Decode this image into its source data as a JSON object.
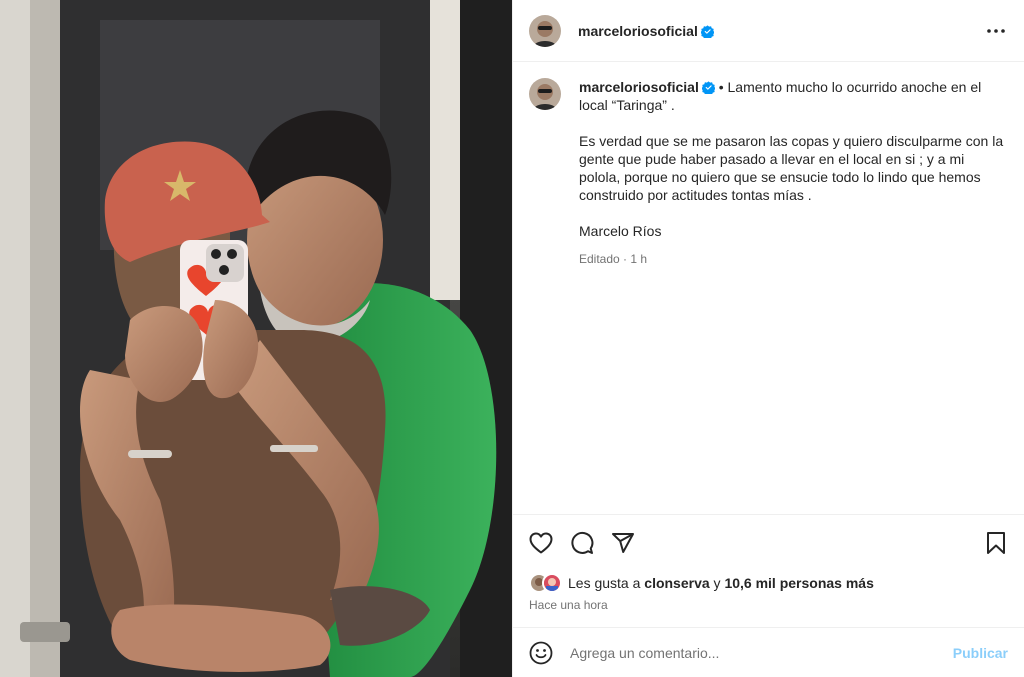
{
  "post": {
    "username": "marceloriosoficial",
    "verified": true
  },
  "caption": {
    "username": "marceloriosoficial",
    "intro": "• Lamento mucho lo ocurrido anoche en el local “Taringa” .",
    "body": "Es verdad que se me pasaron las copas y quiero disculparme con la gente que pude haber pasado a llevar en el local en si ; y a mi polola, porque no quiero que se ensucie todo lo lindo que hemos construido por actitudes tontas mías .",
    "signature": "Marcelo Ríos",
    "edited": "Editado",
    "separator": "·",
    "edited_time": "1 h"
  },
  "likes": {
    "prefix": "Les gusta a",
    "user": "clonserva",
    "conjunction": "y",
    "others": "10,6 mil personas más"
  },
  "timestamp": "Hace una hora",
  "comment": {
    "placeholder": "Agrega un comentario...",
    "publish_label": "Publicar"
  },
  "icons": {
    "more": "more-options-icon",
    "like": "heart-icon",
    "comment": "comment-bubble-icon",
    "share": "paper-plane-icon",
    "save": "bookmark-icon",
    "emoji": "emoji-icon"
  },
  "colors": {
    "verified_blue": "#0095f6",
    "text": "#262626",
    "secondary_text": "#737373",
    "publish_blue": "#0095f6",
    "divider": "#efefef",
    "shirt_green": "#2e9a4c",
    "cap_red": "#c9624e"
  }
}
